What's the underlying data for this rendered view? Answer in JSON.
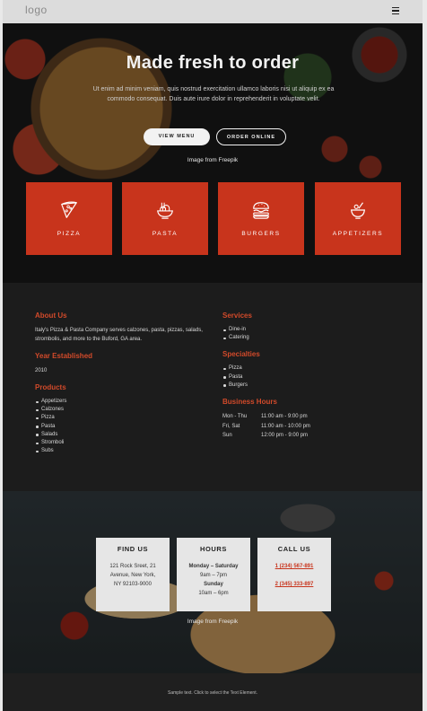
{
  "header": {
    "logo": "logo",
    "menu_icon": "hamburger-menu-icon"
  },
  "hero": {
    "title": "Made fresh to order",
    "text": "Ut enim ad minim veniam, quis nostrud exercitation ullamco laboris nisi ut aliquip ex ea commodo consequat. Duis aute irure dolor in reprehenderit in voluptate velit.",
    "buttons": {
      "view_menu": "VIEW MENU",
      "order_online": "ORDER ONLINE"
    },
    "credit": "Image from Freepik",
    "tiles": [
      {
        "label": "PIZZA",
        "icon": "pizza-slice-icon"
      },
      {
        "label": "PASTA",
        "icon": "pasta-bowl-icon"
      },
      {
        "label": "BURGERS",
        "icon": "burger-icon"
      },
      {
        "label": "APPETIZERS",
        "icon": "appetizer-bowl-icon"
      }
    ]
  },
  "info": {
    "about": {
      "heading": "About Us",
      "text": "Italy's Pizza & Pasta Company serves calzones, pasta, pizzas, salads, strombolis, and more to the Buford, GA area."
    },
    "established": {
      "heading": "Year Established",
      "value": "2010"
    },
    "products": {
      "heading": "Products",
      "items": [
        "Appetizers",
        "Calzones",
        "Pizza",
        "Pasta",
        "Salads",
        "Stromboli",
        "Subs"
      ]
    },
    "services": {
      "heading": "Services",
      "items": [
        "Dine-in",
        "Catering"
      ]
    },
    "specialties": {
      "heading": "Specialties",
      "items": [
        "Pizza",
        "Pasta",
        "Burgers"
      ]
    },
    "hours": {
      "heading": "Business Hours",
      "rows": [
        {
          "day": "Mon - Thu",
          "time": "11:00 am - 9:00 pm"
        },
        {
          "day": "Fri, Sat",
          "time": "11:00 am - 10:00 pm"
        },
        {
          "day": "Sun",
          "time": "12:00 pm - 9:00 pm"
        }
      ]
    }
  },
  "contact": {
    "find_us": {
      "title": "FIND US",
      "lines": [
        "121 Rock Sreet, 21",
        "Avenue, New York,",
        "NY 92103-9000"
      ]
    },
    "hours": {
      "title": "HOURS",
      "lines": [
        "Monday – Saturday",
        "9am – 7pm",
        "Sunday",
        "10am – 6pm"
      ]
    },
    "call_us": {
      "title": "CALL US",
      "phones": [
        "1 (234) 567-891",
        "2 (345) 333-897"
      ]
    },
    "credit": "Image from Freepik"
  },
  "footer": {
    "text": "Sample text. Click to select the Text Element."
  },
  "colors": {
    "accent": "#c8341c",
    "heading_accent": "#d24a2a",
    "dark_bg": "#1c1c1c",
    "header_bg": "#dcdcdc"
  }
}
